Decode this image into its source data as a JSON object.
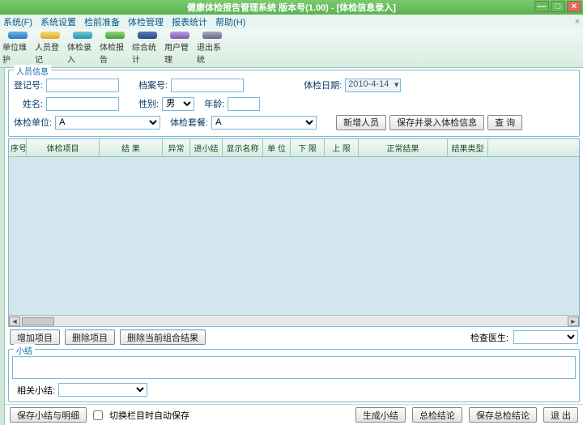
{
  "title": "健康体检报告管理系统 版本号(1.00) - [体检信息录入]",
  "window_controls": {
    "min": "—",
    "max": "□",
    "close": "×"
  },
  "menu": [
    "系统(F)",
    "系统设置",
    "检前准备",
    "体检管理",
    "报表统计",
    "帮助(H)"
  ],
  "mdi_close": "×",
  "toolbar": [
    {
      "label": "单位维护",
      "icon": "ic-blue"
    },
    {
      "label": "人员登记",
      "icon": "ic-yel"
    },
    {
      "label": "体检录入",
      "icon": "ic-cyn"
    },
    {
      "label": "体检报告",
      "icon": "ic-grn"
    },
    {
      "label": "综合统计",
      "icon": "ic-nav"
    },
    {
      "label": "用户管理",
      "icon": "ic-pur"
    },
    {
      "label": "退出系统",
      "icon": "ic-gry"
    }
  ],
  "group_person": "人员信息",
  "form": {
    "reg_no_label": "登记号:",
    "file_no_label": "档案号:",
    "exam_date_label": "体检日期:",
    "exam_date_value": "2010-4-14",
    "name_label": "姓名:",
    "gender_label": "性别:",
    "gender_value": "男",
    "age_label": "年龄:",
    "unit_label": "体检单位:",
    "unit_value": "A",
    "package_label": "体检套餐:",
    "package_value": "A"
  },
  "buttons": {
    "add_person": "新增人员",
    "save_enter": "保存并录入体检信息",
    "query": "查 询"
  },
  "grid": {
    "cols": [
      {
        "label": "序号",
        "w": 22
      },
      {
        "label": "体检项目",
        "w": 90
      },
      {
        "label": "结 果",
        "w": 78
      },
      {
        "label": "异常",
        "w": 34
      },
      {
        "label": "进小结",
        "w": 40
      },
      {
        "label": "显示名称",
        "w": 50
      },
      {
        "label": "单 位",
        "w": 34
      },
      {
        "label": "下 限",
        "w": 42
      },
      {
        "label": "上 限",
        "w": 42
      },
      {
        "label": "正常结果",
        "w": 110
      },
      {
        "label": "结果类型",
        "w": 50
      }
    ]
  },
  "below_grid": {
    "add_item": "增加项目",
    "del_item": "删除项目",
    "del_combo": "删除当前组合结果",
    "doctor_label": "检查医生:"
  },
  "summary": {
    "legend": "小结",
    "related_label": "相关小结:"
  },
  "bottom": {
    "save_summary": "保存小结与明细",
    "auto_save": "切换栏目时自动保存",
    "gen_summary": "生成小结",
    "total_conclusion": "总检结论",
    "save_total": "保存总检结论",
    "exit": "退 出"
  }
}
